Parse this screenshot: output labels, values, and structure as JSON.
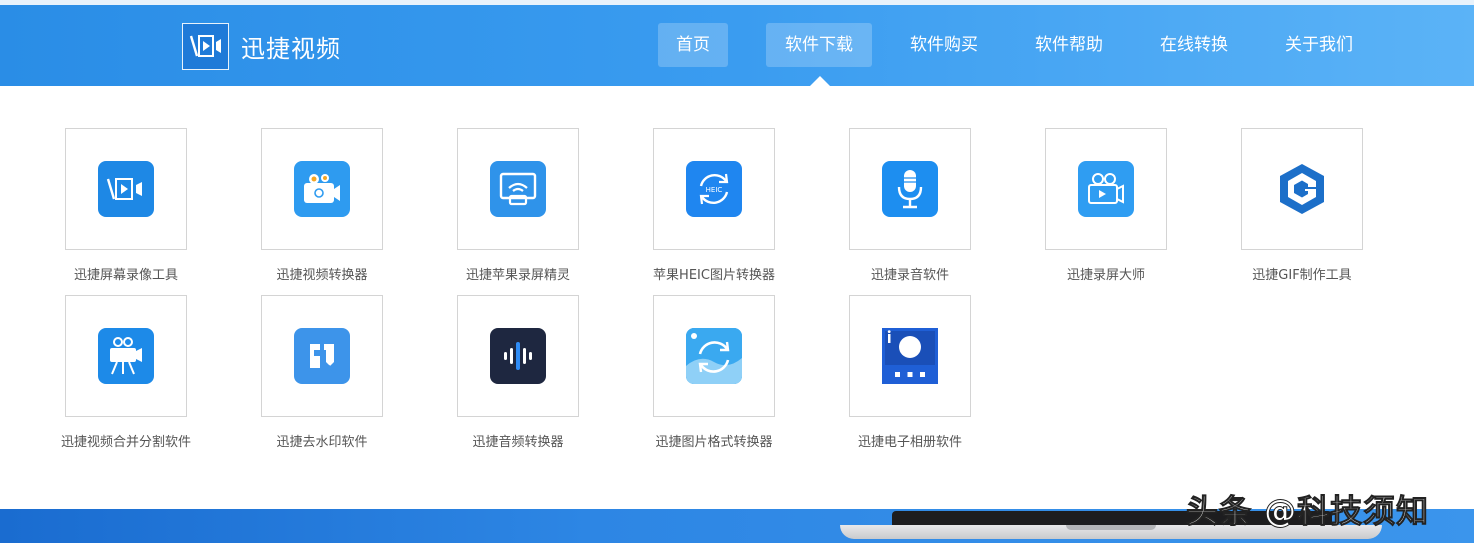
{
  "brand": {
    "name": "迅捷视频"
  },
  "nav": {
    "items": [
      {
        "label": "首页",
        "state": "home"
      },
      {
        "label": "软件下载",
        "state": "active"
      },
      {
        "label": "软件购买",
        "state": ""
      },
      {
        "label": "软件帮助",
        "state": ""
      },
      {
        "label": "在线转换",
        "state": ""
      },
      {
        "label": "关于我们",
        "state": ""
      }
    ]
  },
  "products": [
    {
      "name": "迅捷屏幕录像工具",
      "icon": "screen-recorder-icon",
      "color": "#1e88e5"
    },
    {
      "name": "迅捷视频转换器",
      "icon": "video-converter-icon",
      "color": "#2e9bf0"
    },
    {
      "name": "迅捷苹果录屏精灵",
      "icon": "airplay-recorder-icon",
      "color": "#2f93ea"
    },
    {
      "name": "苹果HEIC图片转换器",
      "icon": "heic-converter-icon",
      "color": "#1f86f0"
    },
    {
      "name": "迅捷录音软件",
      "icon": "microphone-icon",
      "color": "#1d8ef0"
    },
    {
      "name": "迅捷录屏大师",
      "icon": "camera-recorder-icon",
      "color": "#2f9df2"
    },
    {
      "name": "迅捷GIF制作工具",
      "icon": "gif-maker-icon",
      "color": "#1c6fc9"
    },
    {
      "name": "迅捷视频合并分割软件",
      "icon": "video-merge-icon",
      "color": "#1d8ae8"
    },
    {
      "name": "迅捷去水印软件",
      "icon": "watermark-remover-icon",
      "color": "#3d94ea"
    },
    {
      "name": "迅捷音频转换器",
      "icon": "audio-converter-icon",
      "color": "#1e2740"
    },
    {
      "name": "迅捷图片格式转换器",
      "icon": "image-converter-icon",
      "color": "#3aa9f0"
    },
    {
      "name": "迅捷电子相册软件",
      "icon": "photo-album-icon",
      "color": "#1f5fd6"
    }
  ],
  "watermark": {
    "text": "头条 @科技须知"
  }
}
